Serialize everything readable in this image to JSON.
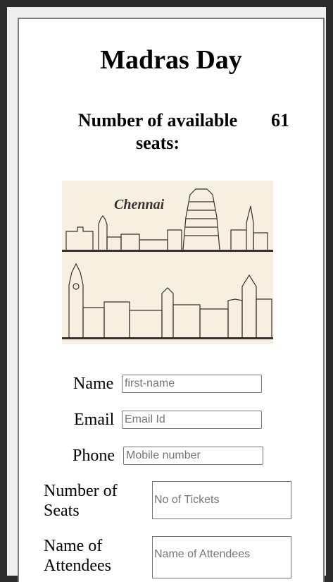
{
  "event": {
    "title": "Madras Day"
  },
  "seats": {
    "label": "Number of available seats:",
    "count": "61"
  },
  "banner": {
    "caption": "Chennai"
  },
  "form": {
    "name_label": "Name",
    "name_placeholder": "first-name",
    "email_label": "Email",
    "email_placeholder": "Email Id",
    "phone_label": "Phone",
    "phone_placeholder": "Mobile number",
    "seats_label": "Number of Seats",
    "seats_placeholder": "No of Tickets",
    "attendees_label": "Name of Attendees",
    "attendees_placeholder": "Name of Attendees"
  }
}
